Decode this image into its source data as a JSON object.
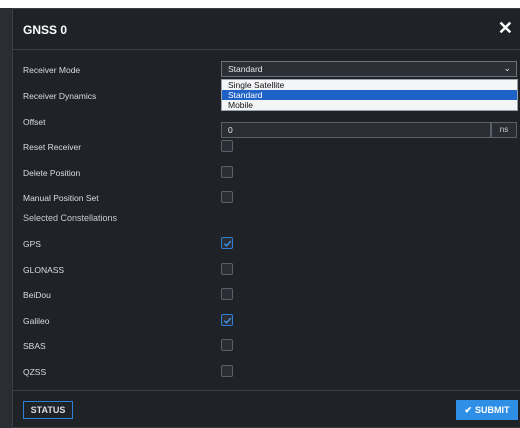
{
  "dialog": {
    "title": "GNSS 0",
    "close_icon": "close-icon",
    "close_glyph": "✕"
  },
  "receiver_mode": {
    "label": "Receiver Mode",
    "value": "Standard",
    "options": [
      "Single Satellite",
      "Standard",
      "Mobile"
    ],
    "selected_index": 1
  },
  "receiver_dynamics": {
    "label": "Receiver Dynamics"
  },
  "offset": {
    "label": "Offset",
    "value": "0",
    "unit": "ns"
  },
  "toggles": [
    {
      "label": "Reset Receiver",
      "checked": false
    },
    {
      "label": "Delete Position",
      "checked": false
    },
    {
      "label": "Manual Position Set",
      "checked": false
    }
  ],
  "constellations": {
    "label": "Selected Constellations",
    "items": [
      {
        "label": "GPS",
        "checked": true
      },
      {
        "label": "GLONASS",
        "checked": false
      },
      {
        "label": "BeiDou",
        "checked": false
      },
      {
        "label": "Galileo",
        "checked": true
      },
      {
        "label": "SBAS",
        "checked": false
      },
      {
        "label": "QZSS",
        "checked": false
      }
    ]
  },
  "footer": {
    "status_label": "STATUS",
    "submit_label": "SUBMIT",
    "submit_icon": "check-icon"
  },
  "colors": {
    "accent": "#2f8fe6",
    "background": "#1f2227",
    "checked_border": "#2f7fd6"
  }
}
